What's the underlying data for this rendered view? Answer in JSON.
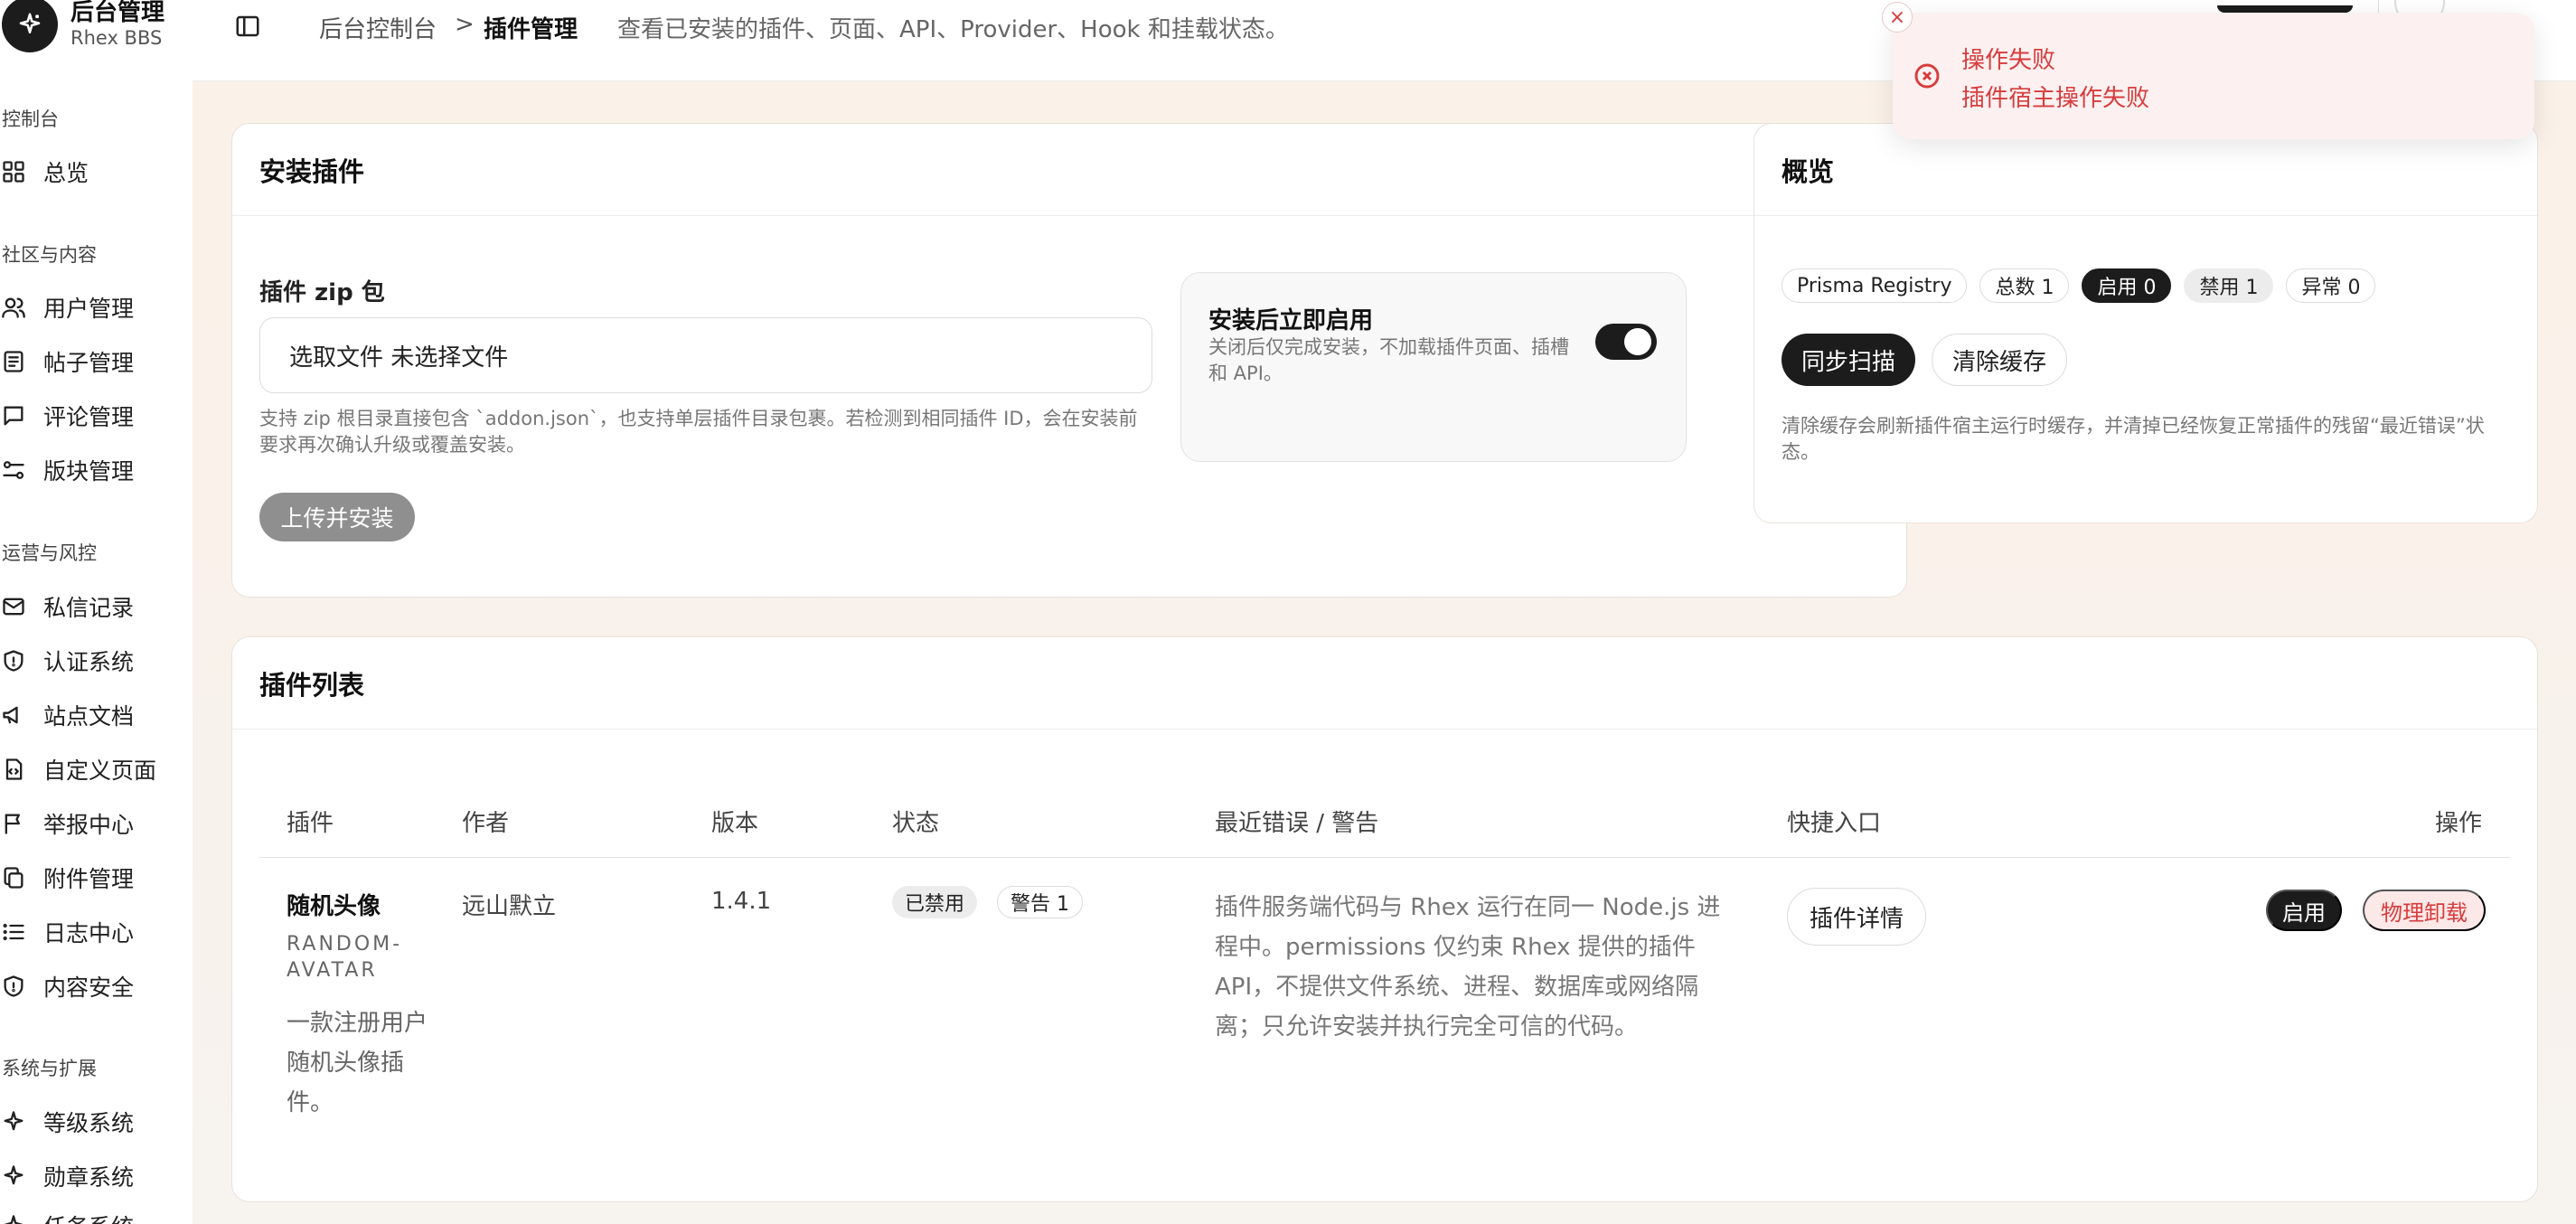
{
  "brand": {
    "title": "后台管理",
    "subtitle": "Rhex BBS"
  },
  "sidebar": {
    "groups": [
      {
        "label": "控制台",
        "items": [
          {
            "label": "总览",
            "icon": "grid-icon"
          }
        ]
      },
      {
        "label": "社区与内容",
        "items": [
          {
            "label": "用户管理",
            "icon": "users-icon"
          },
          {
            "label": "帖子管理",
            "icon": "document-icon"
          },
          {
            "label": "评论管理",
            "icon": "message-square-icon"
          },
          {
            "label": "版块管理",
            "icon": "sliders-icon"
          }
        ]
      },
      {
        "label": "运营与风控",
        "items": [
          {
            "label": "私信记录",
            "icon": "mail-icon"
          },
          {
            "label": "认证系统",
            "icon": "shield-icon"
          },
          {
            "label": "站点文档",
            "icon": "megaphone-icon"
          },
          {
            "label": "自定义页面",
            "icon": "file-code-icon"
          },
          {
            "label": "举报中心",
            "icon": "flag-icon"
          },
          {
            "label": "附件管理",
            "icon": "copy-icon"
          },
          {
            "label": "日志中心",
            "icon": "list-icon"
          },
          {
            "label": "内容安全",
            "icon": "shield-icon"
          }
        ]
      },
      {
        "label": "系统与扩展",
        "items": [
          {
            "label": "等级系统",
            "icon": "sparkles-icon"
          },
          {
            "label": "勋章系统",
            "icon": "sparkles-icon"
          },
          {
            "label": "任务系统",
            "icon": "sparkles-icon"
          }
        ]
      }
    ]
  },
  "header": {
    "breadcrumb_root": "后台控制台",
    "breadcrumb_sep": ">",
    "breadcrumb_current": "插件管理",
    "description": "查看已安装的插件、页面、API、Provider、Hook 和挂载状态。"
  },
  "install": {
    "title": "安装插件",
    "zip_label": "插件 zip 包",
    "file_text": "选取文件  未选择文件",
    "help": "支持 zip 根目录直接包含 `addon.json`，也支持单层插件目录包裹。若检测到相同插件 ID，会在安装前要求再次确认升级或覆盖安装。",
    "upload_button": "上传并安装",
    "toggle_title": "安装后立即启用",
    "toggle_desc": "关闭后仅完成安装，不加载插件页面、插槽和 API。",
    "toggle_on": true
  },
  "overview": {
    "title": "概览",
    "pills": [
      "Prisma Registry",
      "总数 1",
      "启用 0",
      "禁用 1",
      "异常 0"
    ],
    "sync_button": "同步扫描",
    "clear_button": "清除缓存",
    "note": "清除缓存会刷新插件宿主运行时缓存，并清掉已经恢复正常插件的残留“最近错误”状态。"
  },
  "plugin_list": {
    "title": "插件列表",
    "columns": [
      "插件",
      "作者",
      "版本",
      "状态",
      "最近错误 / 警告",
      "快捷入口",
      "操作"
    ],
    "rows": [
      {
        "name": "随机头像",
        "slug": "RANDOM-AVATAR",
        "description": "一款注册用户随机头像插件。",
        "author": "远山默立",
        "version": "1.4.1",
        "status": "已禁用",
        "warning": "警告 1",
        "message": "插件服务端代码与 Rhex 运行在同一 Node.js 进程中。permissions 仅约束 Rhex 提供的插件 API，不提供文件系统、进程、数据库或网络隔离；只允许安装并执行完全可信的代码。",
        "shortcut": "插件详情",
        "enable_action": "启用",
        "uninstall_action": "物理卸载"
      }
    ]
  },
  "toast": {
    "title": "操作失败",
    "message": "插件宿主操作失败",
    "close": "×",
    "color": "#d63d3d"
  }
}
